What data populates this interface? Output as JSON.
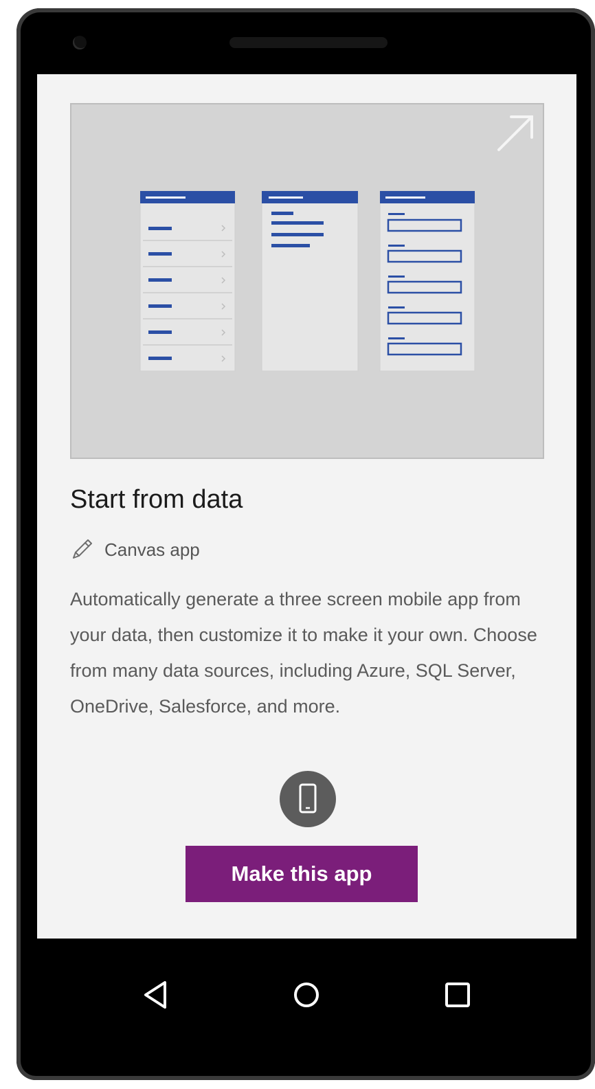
{
  "card": {
    "title": "Start from data",
    "app_type_icon": "pencil-icon",
    "app_type": "Canvas app",
    "description": "Automatically generate a three screen mobile app from your data, then customize it to make it your own. Choose from many data sources, including Azure, SQL Server, OneDrive, Salesforce, and more.",
    "hero_expand_icon": "expand-arrow-icon",
    "device_icon": "mobile-phone-icon",
    "button_label": "Make this app"
  },
  "navigation": {
    "back_icon": "back-triangle-icon",
    "home_icon": "home-circle-icon",
    "recents_icon": "recents-square-icon"
  },
  "colors": {
    "accent": "#7b1e7a",
    "hero_blue": "#2b4fa5",
    "screen_background": "#f3f3f3",
    "hero_background": "#d4d4d4",
    "device_badge": "#5c5c5c",
    "phone_frame": "#000000"
  }
}
